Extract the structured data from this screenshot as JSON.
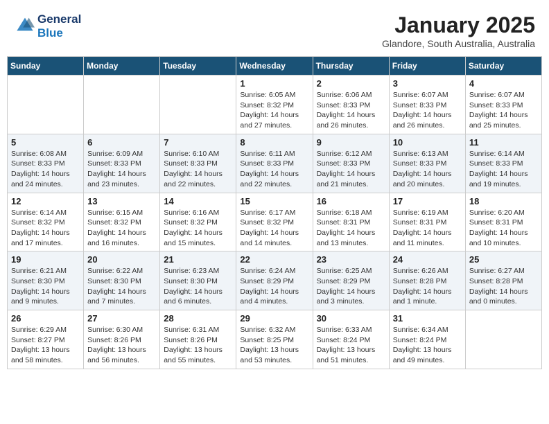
{
  "header": {
    "logo_line1": "General",
    "logo_line2": "Blue",
    "month_title": "January 2025",
    "location": "Glandore, South Australia, Australia"
  },
  "weekdays": [
    "Sunday",
    "Monday",
    "Tuesday",
    "Wednesday",
    "Thursday",
    "Friday",
    "Saturday"
  ],
  "weeks": [
    [
      null,
      null,
      null,
      {
        "day": 1,
        "sunrise": "6:05 AM",
        "sunset": "8:32 PM",
        "daylight": "14 hours and 27 minutes."
      },
      {
        "day": 2,
        "sunrise": "6:06 AM",
        "sunset": "8:33 PM",
        "daylight": "14 hours and 26 minutes."
      },
      {
        "day": 3,
        "sunrise": "6:07 AM",
        "sunset": "8:33 PM",
        "daylight": "14 hours and 26 minutes."
      },
      {
        "day": 4,
        "sunrise": "6:07 AM",
        "sunset": "8:33 PM",
        "daylight": "14 hours and 25 minutes."
      }
    ],
    [
      {
        "day": 5,
        "sunrise": "6:08 AM",
        "sunset": "8:33 PM",
        "daylight": "14 hours and 24 minutes."
      },
      {
        "day": 6,
        "sunrise": "6:09 AM",
        "sunset": "8:33 PM",
        "daylight": "14 hours and 23 minutes."
      },
      {
        "day": 7,
        "sunrise": "6:10 AM",
        "sunset": "8:33 PM",
        "daylight": "14 hours and 22 minutes."
      },
      {
        "day": 8,
        "sunrise": "6:11 AM",
        "sunset": "8:33 PM",
        "daylight": "14 hours and 22 minutes."
      },
      {
        "day": 9,
        "sunrise": "6:12 AM",
        "sunset": "8:33 PM",
        "daylight": "14 hours and 21 minutes."
      },
      {
        "day": 10,
        "sunrise": "6:13 AM",
        "sunset": "8:33 PM",
        "daylight": "14 hours and 20 minutes."
      },
      {
        "day": 11,
        "sunrise": "6:14 AM",
        "sunset": "8:33 PM",
        "daylight": "14 hours and 19 minutes."
      }
    ],
    [
      {
        "day": 12,
        "sunrise": "6:14 AM",
        "sunset": "8:32 PM",
        "daylight": "14 hours and 17 minutes."
      },
      {
        "day": 13,
        "sunrise": "6:15 AM",
        "sunset": "8:32 PM",
        "daylight": "14 hours and 16 minutes."
      },
      {
        "day": 14,
        "sunrise": "6:16 AM",
        "sunset": "8:32 PM",
        "daylight": "14 hours and 15 minutes."
      },
      {
        "day": 15,
        "sunrise": "6:17 AM",
        "sunset": "8:32 PM",
        "daylight": "14 hours and 14 minutes."
      },
      {
        "day": 16,
        "sunrise": "6:18 AM",
        "sunset": "8:31 PM",
        "daylight": "14 hours and 13 minutes."
      },
      {
        "day": 17,
        "sunrise": "6:19 AM",
        "sunset": "8:31 PM",
        "daylight": "14 hours and 11 minutes."
      },
      {
        "day": 18,
        "sunrise": "6:20 AM",
        "sunset": "8:31 PM",
        "daylight": "14 hours and 10 minutes."
      }
    ],
    [
      {
        "day": 19,
        "sunrise": "6:21 AM",
        "sunset": "8:30 PM",
        "daylight": "14 hours and 9 minutes."
      },
      {
        "day": 20,
        "sunrise": "6:22 AM",
        "sunset": "8:30 PM",
        "daylight": "14 hours and 7 minutes."
      },
      {
        "day": 21,
        "sunrise": "6:23 AM",
        "sunset": "8:30 PM",
        "daylight": "14 hours and 6 minutes."
      },
      {
        "day": 22,
        "sunrise": "6:24 AM",
        "sunset": "8:29 PM",
        "daylight": "14 hours and 4 minutes."
      },
      {
        "day": 23,
        "sunrise": "6:25 AM",
        "sunset": "8:29 PM",
        "daylight": "14 hours and 3 minutes."
      },
      {
        "day": 24,
        "sunrise": "6:26 AM",
        "sunset": "8:28 PM",
        "daylight": "14 hours and 1 minute."
      },
      {
        "day": 25,
        "sunrise": "6:27 AM",
        "sunset": "8:28 PM",
        "daylight": "14 hours and 0 minutes."
      }
    ],
    [
      {
        "day": 26,
        "sunrise": "6:29 AM",
        "sunset": "8:27 PM",
        "daylight": "13 hours and 58 minutes."
      },
      {
        "day": 27,
        "sunrise": "6:30 AM",
        "sunset": "8:26 PM",
        "daylight": "13 hours and 56 minutes."
      },
      {
        "day": 28,
        "sunrise": "6:31 AM",
        "sunset": "8:26 PM",
        "daylight": "13 hours and 55 minutes."
      },
      {
        "day": 29,
        "sunrise": "6:32 AM",
        "sunset": "8:25 PM",
        "daylight": "13 hours and 53 minutes."
      },
      {
        "day": 30,
        "sunrise": "6:33 AM",
        "sunset": "8:24 PM",
        "daylight": "13 hours and 51 minutes."
      },
      {
        "day": 31,
        "sunrise": "6:34 AM",
        "sunset": "8:24 PM",
        "daylight": "13 hours and 49 minutes."
      },
      null
    ]
  ],
  "labels": {
    "sunrise": "Sunrise:",
    "sunset": "Sunset:",
    "daylight": "Daylight:"
  }
}
